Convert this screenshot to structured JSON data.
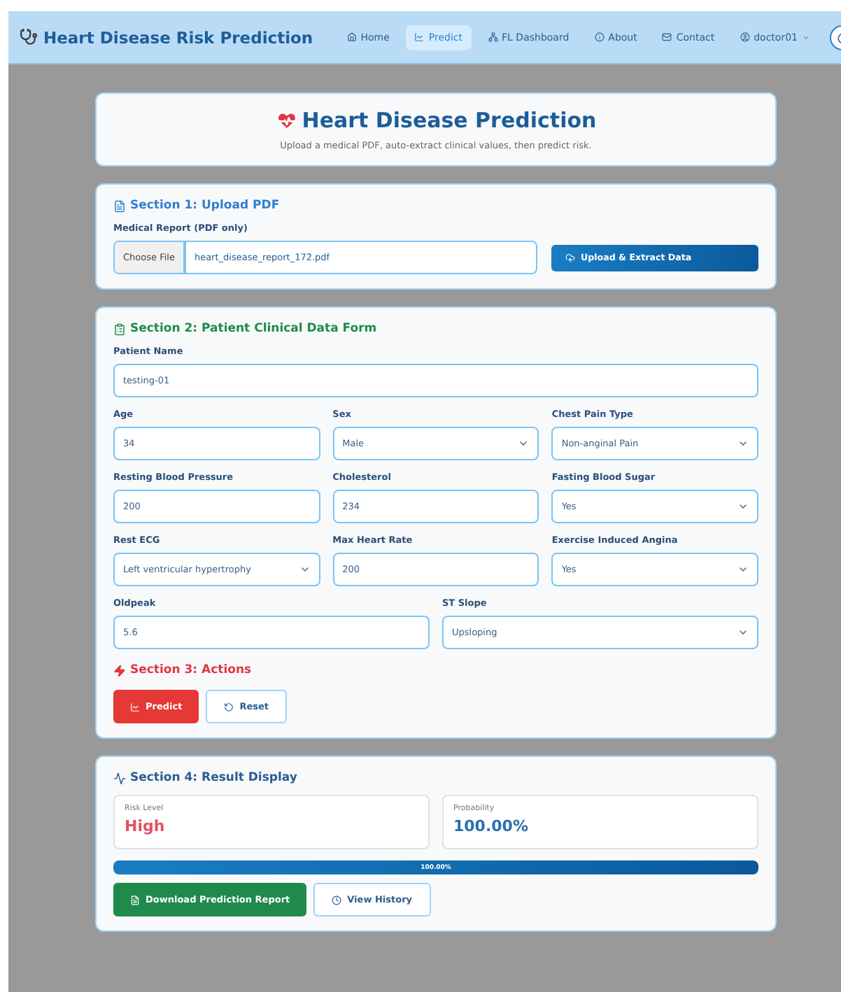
{
  "nav": {
    "brand": "Heart Disease Risk Prediction",
    "items": [
      {
        "label": "Home",
        "selected": false
      },
      {
        "label": "Predict",
        "selected": true
      },
      {
        "label": "FL Dashboard",
        "selected": false
      },
      {
        "label": "About",
        "selected": false
      },
      {
        "label": "Contact",
        "selected": false
      }
    ],
    "user": "doctor01"
  },
  "header": {
    "title": "Heart Disease Prediction",
    "subtitle": "Upload a medical PDF, auto-extract clinical values, then predict risk."
  },
  "upload": {
    "heading": "Section 1: Upload PDF",
    "label": "Medical Report (PDF only)",
    "choose_button": "Choose File",
    "file_name": "heart_disease_report_172.pdf",
    "extract_button": "Upload & Extract Data"
  },
  "form": {
    "heading": "Section 2: Patient Clinical Data Form",
    "rows": [
      [
        {
          "label": "Patient Name",
          "value": "testing-01",
          "kind": "text"
        }
      ],
      [
        {
          "label": "Age",
          "value": "34",
          "kind": "text"
        },
        {
          "label": "Sex",
          "value": "Male",
          "kind": "select"
        },
        {
          "label": "Chest Pain Type",
          "value": "Non-anginal Pain",
          "kind": "select"
        }
      ],
      [
        {
          "label": "Resting Blood Pressure",
          "value": "200",
          "kind": "text"
        },
        {
          "label": "Cholesterol",
          "value": "234",
          "kind": "text"
        },
        {
          "label": "Fasting Blood Sugar",
          "value": "Yes",
          "kind": "select"
        }
      ],
      [
        {
          "label": "Rest ECG",
          "value": "Left ventricular hypertrophy",
          "kind": "select"
        },
        {
          "label": "Max Heart Rate",
          "value": "200",
          "kind": "text"
        },
        {
          "label": "Exercise Induced Angina",
          "value": "Yes",
          "kind": "select"
        }
      ],
      [
        {
          "label": "Oldpeak",
          "value": "5.6",
          "kind": "text"
        },
        {
          "label": "ST Slope",
          "value": "Upsloping",
          "kind": "select"
        }
      ]
    ]
  },
  "actions": {
    "heading": "Section 3: Actions",
    "buttons": [
      {
        "label": "Predict",
        "kind": "primary"
      },
      {
        "label": "Reset",
        "kind": "outline"
      }
    ]
  },
  "result": {
    "heading": "Section 4: Result Display",
    "risk_label": "Risk Level",
    "risk_value": "High",
    "probability_label": "Probability",
    "probability_value": "100.00%",
    "progress": {
      "level": 1,
      "label": "100.00%"
    },
    "buttons": [
      {
        "label": "Download Prediction Report",
        "kind": "primary"
      },
      {
        "label": "View History",
        "kind": "outline"
      }
    ]
  }
}
